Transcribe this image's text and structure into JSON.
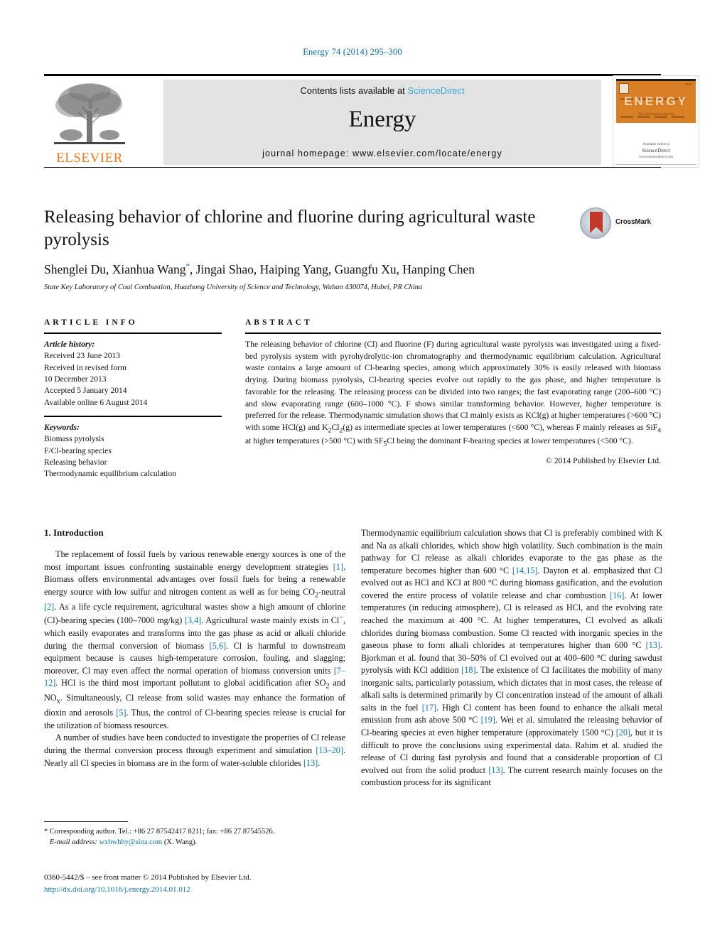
{
  "running_head": "Energy 74 (2014) 295–300",
  "masthead": {
    "publisher_name": "ELSEVIER",
    "contents_prefix": "Contents lists available at",
    "sciencedirect": "ScienceDirect",
    "journal_name": "Energy",
    "homepage": "journal homepage: www.elsevier.com/locate/energy",
    "cover": {
      "title": "ENERGY",
      "subtitle": "The International Journal",
      "issue_label": "ISSN",
      "footer_line1": "Available online at",
      "footer_line2": "ScienceDirect",
      "footer_line3": "www.sciencedirect.com"
    }
  },
  "article": {
    "title": "Releasing behavior of chlorine and fluorine during agricultural waste pyrolysis",
    "authors": "Shenglei Du, Xianhua Wang",
    "authors_rest": ", Jingai Shao, Haiping Yang, Guangfu Xu, Hanping Chen",
    "corresponding_marker": "*",
    "affiliation": "State Key Laboratory of Coal Combustion, Huazhong University of Science and Technology, Wuhan 430074, Hubei, PR China",
    "crossmark_label": "CrossMark"
  },
  "article_info": {
    "heading": "ARTICLE INFO",
    "history_label": "Article history:",
    "history": [
      "Received 23 June 2013",
      "Received in revised form",
      "10 December 2013",
      "Accepted 5 January 2014",
      "Available online 6 August 2014"
    ],
    "keywords_label": "Keywords:",
    "keywords": [
      "Biomass pyrolysis",
      "F/Cl-bearing species",
      "Releasing behavior",
      "Thermodynamic equilibrium calculation"
    ]
  },
  "abstract": {
    "heading": "ABSTRACT",
    "text": "The releasing behavior of chlorine (Cl) and fluorine (F) during agricultural waste pyrolysis was investigated using a fixed-bed pyrolysis system with pyrohydrolytic-ion chromatography and thermodynamic equilibrium calculation. Agricultural waste contains a large amount of Cl-bearing species, among which approximately 30% is easily released with biomass drying. During biomass pyrolysis, Cl-bearing species evolve out rapidly to the gas phase, and higher temperature is favorable for the releasing. The releasing process can be divided into two ranges; the fast evaporating range (200–600 °C) and slow evaporating range (600–1000 °C). F shows similar transforming behavior. However, higher temperature is preferred for the release. Thermodynamic simulation shows that Cl mainly exists as KCl(g) at higher temperatures (>600 °C) with some HCl(g) and K2Cl2(g) as intermediate species at lower temperatures (<600 °C), whereas F mainly releases as SiF4 at higher temperatures (>500 °C) with SF5Cl being the dominant F-bearing species at lower temperatures (<500 °C).",
    "copyright": "© 2014 Published by Elsevier Ltd."
  },
  "introduction": {
    "heading": "1. Introduction",
    "left_paragraphs": [
      "The replacement of fossil fuels by various renewable energy sources is one of the most important issues confronting sustainable energy development strategies [1]. Biomass offers environmental advantages over fossil fuels for being a renewable energy source with low sulfur and nitrogen content as well as for being CO2-neutral [2]. As a life cycle requirement, agricultural wastes show a high amount of chlorine (Cl)-bearing species (100–7000 mg/kg) [3,4]. Agricultural waste mainly exists in Cl−, which easily evaporates and transforms into the gas phase as acid or alkali chloride during the thermal conversion of biomass [5,6]. Cl is harmful to downstream equipment because is causes high-temperature corrosion, fouling, and slagging; moreover, Cl may even affect the normal operation of biomass conversion units [7–12]. HCl is the third most important pollutant to global acidification after SO2 and NOx. Simultaneously, Cl release from solid wastes may enhance the formation of dioxin and aerosols [5]. Thus, the control of Cl-bearing species release is crucial for the utilization of biomass resources.",
      "A number of studies have been conducted to investigate the properties of Cl release during the thermal conversion process through experiment and simulation [13–20]. Nearly all Cl species in biomass are in the form of water-soluble chlorides [13]."
    ],
    "right_paragraphs": [
      "Thermodynamic equilibrium calculation shows that Cl is preferably combined with K and Na as alkali chlorides, which show high volatility. Such combination is the main pathway for Cl release as alkali chlorides evaporate to the gas phase as the temperature becomes higher than 600 °C [14,15]. Dayton et al. emphasized that Cl evolved out as HCl and KCl at 800 °C during biomass gasification, and the evolution covered the entire process of volatile release and char combustion [16]. At lower temperatures (in reducing atmosphere), Cl is released as HCl, and the evolving rate reached the maximum at 400 °C. At higher temperatures, Cl evolved as alkali chlorides during biomass combustion. Some Cl reacted with inorganic species in the gaseous phase to form alkali chlorides at temperatures higher than 600 °C [13]. Bjorkman et al. found that 30–50% of Cl evolved out at 400–600 °C during sawdust pyrolysis with KCl addition [18]. The existence of Cl facilitates the mobility of many inorganic salts, particularly potassium, which dictates that in most cases, the release of alkali salts is determined primarily by Cl concentration instead of the amount of alkali salts in the fuel [17]. High Cl content has been found to enhance the alkali metal emission from ash above 500 °C [19]. Wei et al. simulated the releasing behavior of Cl-bearing species at even higher temperature (approximately 1500 °C) [20], but it is difficult to prove the conclusions using experimental data. Rahim et al. studied the release of Cl during fast pyrolysis and found that a considerable proportion of Cl evolved out from the solid product [13]. The current research mainly focuses on the combustion process for its significant"
    ]
  },
  "footnote": {
    "corresponding": "* Corresponding author. Tel.: +86 27 87542417 8211; fax: +86 27 87545526.",
    "email_label": "E-mail address:",
    "email": "wxhwhhy@sina.com",
    "email_owner": "(X. Wang)."
  },
  "imprint": {
    "issn_line": "0360-5442/$ – see front matter © 2014 Published by Elsevier Ltd.",
    "doi": "http://dx.doi.org/10.1016/j.energy.2014.01.012"
  },
  "colors": {
    "link": "#1273a8",
    "running_head": "#0b6ca3",
    "sciencedirect": "#3aa7d8",
    "elsevier_orange": "#e87d1e",
    "cover_orange": "#d98026",
    "crossmark_red": "#c0392b"
  }
}
